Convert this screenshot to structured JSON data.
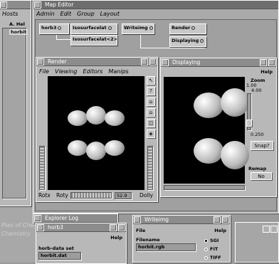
{
  "desktop_bg_texts": [
    "Plan of Chemistry",
    "Chemistry"
  ],
  "left_window": {
    "menu": [
      "Hosts"
    ],
    "header_partial": "A. Hel",
    "list_item": "horbit"
  },
  "map_editor": {
    "title": "Map Editor",
    "menu": [
      "Admin",
      "Edit",
      "Group",
      "Layout"
    ],
    "nodes": [
      "horb3",
      "Isosurfacelat",
      "Isosurfacelat<2>",
      "Writeimg",
      "Render",
      "Displaying"
    ]
  },
  "render": {
    "title": "Render",
    "menu": [
      "File",
      "Viewing",
      "Editors",
      "Manips"
    ],
    "bottom": {
      "rotx": "Rotx",
      "roty": "Roty",
      "value": "52.9",
      "dolly": "Dolly"
    }
  },
  "displaying": {
    "title": "Displaying",
    "help": "Help",
    "zoom_label": "Zoom",
    "zoom_top": "1.00",
    "zoom_mid": "4.00",
    "zoom_bottom": "0.250",
    "snap_label": "Snap?",
    "remap_label": "Remap",
    "remap_value": "No"
  },
  "explorer_log": {
    "title": "Explorer Log"
  },
  "horb3": {
    "title": "horb3",
    "help": "Help",
    "field_label": "horb-data set",
    "field_value": "horbit.dat"
  },
  "writeimg": {
    "title": "Writeimg",
    "file_menu": "File",
    "help": "Help",
    "filename_label": "Filename",
    "filename_value": "horbit.rgb",
    "options": [
      "SGI",
      "FIT",
      "TIFF"
    ]
  },
  "colors": {
    "desktop": "#9a9a9a",
    "panel": "#b8b8b8",
    "title_active": "#6e6e6e",
    "viewport": "#000000",
    "orbital": "#e6e6e6"
  }
}
